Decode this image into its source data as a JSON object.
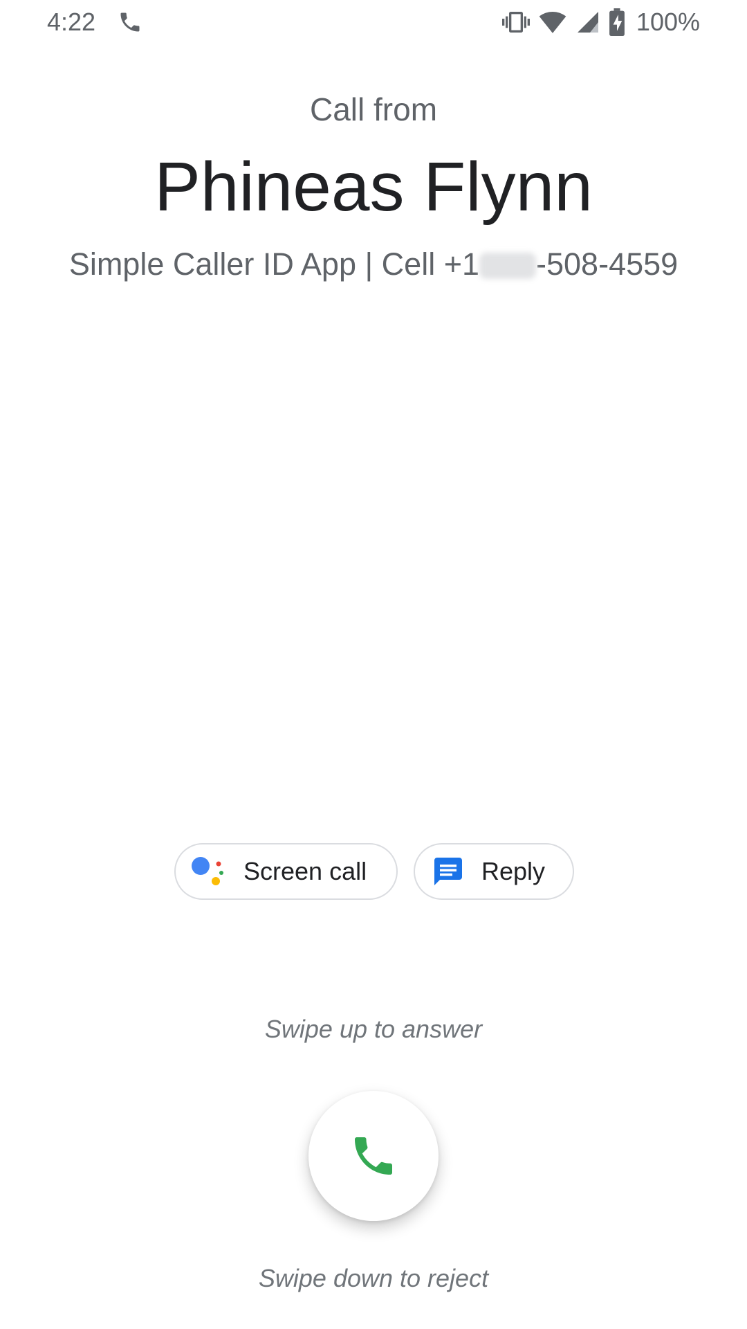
{
  "status_bar": {
    "time": "4:22",
    "call_icon": "phone-icon",
    "vibrate_icon": "vibrate-icon",
    "wifi_icon": "wifi-icon",
    "signal_icon": "cell-signal-icon",
    "battery_icon": "battery-charging-icon",
    "battery_level": "100%"
  },
  "caller": {
    "label": "Call from",
    "name": "Phineas Flynn",
    "detail_prefix": "Simple Caller ID App | Cell +1",
    "detail_suffix": "-508-4559"
  },
  "actions": {
    "screen_call": {
      "label": "Screen call",
      "icon": "google-assistant-icon"
    },
    "reply": {
      "label": "Reply",
      "icon": "message-icon"
    }
  },
  "hints": {
    "answer": "Swipe up to answer",
    "reject": "Swipe down to reject"
  },
  "answer_button": {
    "icon": "phone-answer-icon"
  },
  "colors": {
    "answer_green": "#34a853",
    "reply_blue": "#1a73e8",
    "assistant_blue": "#4285f4",
    "assistant_red": "#ea4335",
    "assistant_yellow": "#fbbc05",
    "assistant_green": "#34a853",
    "text_secondary": "#5f6368",
    "text_primary": "#202124"
  }
}
